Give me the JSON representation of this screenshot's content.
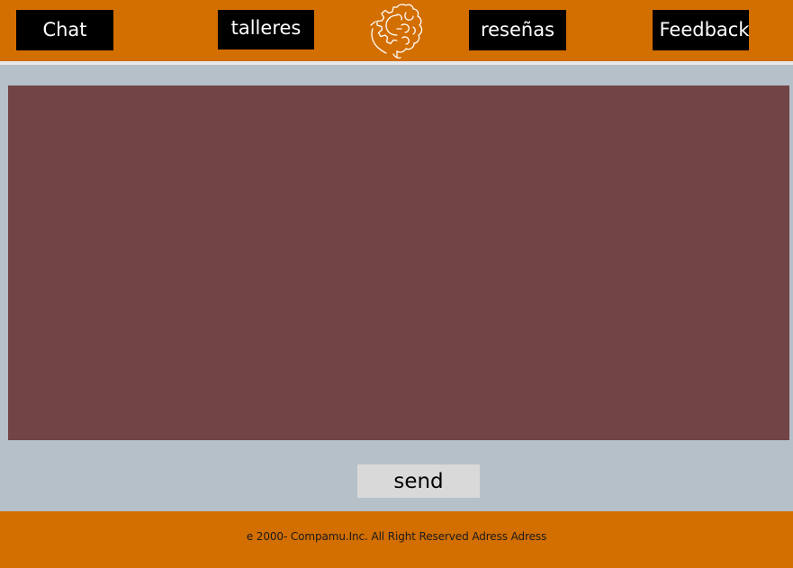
{
  "nav": {
    "chat_label": "Chat",
    "talleres_label": "talleres",
    "resenas_label": "reseñas",
    "feedback_label": "Feedback"
  },
  "logo": {
    "icon": "brain-gear-icon"
  },
  "chat": {
    "send_label": "send"
  },
  "footer": {
    "text": "e 2000- Compamu.Inc. All Right Reserved Adress Adress"
  },
  "colors": {
    "header_bg": "#d36e00",
    "page_bg": "#b6c0c8",
    "panel_bg": "#714446",
    "nav_button_bg": "#000000",
    "send_button_bg": "#d9d9d9"
  }
}
